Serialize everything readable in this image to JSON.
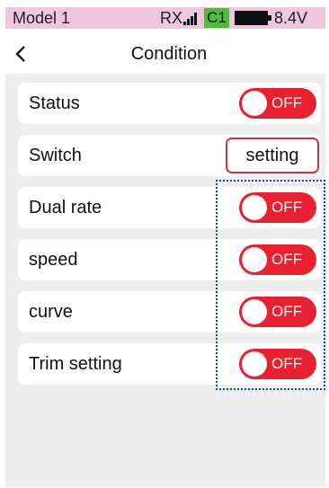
{
  "status_bar": {
    "model_name": "Model 1",
    "rx_label": "RX",
    "signal_icon": "signal-bars-icon",
    "channel_badge": "C1",
    "battery_icon": "battery-icon",
    "voltage": "8.4V",
    "background_color": "#efc6de",
    "channel_badge_color": "#4cbf37"
  },
  "header": {
    "back_icon": "chevron-left-icon",
    "back_glyph": "<",
    "title": "Condition"
  },
  "rows": [
    {
      "label": "Status",
      "control": "toggle",
      "value": "OFF"
    },
    {
      "label": "Switch",
      "control": "button",
      "value": "setting"
    },
    {
      "label": "Dual rate",
      "control": "toggle",
      "value": "OFF"
    },
    {
      "label": "speed",
      "control": "toggle",
      "value": "OFF"
    },
    {
      "label": "curve",
      "control": "toggle",
      "value": "OFF"
    },
    {
      "label": "Trim setting",
      "control": "toggle",
      "value": "OFF"
    }
  ],
  "colors": {
    "toggle_off": "#e8202f",
    "panel_bg": "#eeeeee",
    "highlight_border": "#1f3f8a"
  }
}
